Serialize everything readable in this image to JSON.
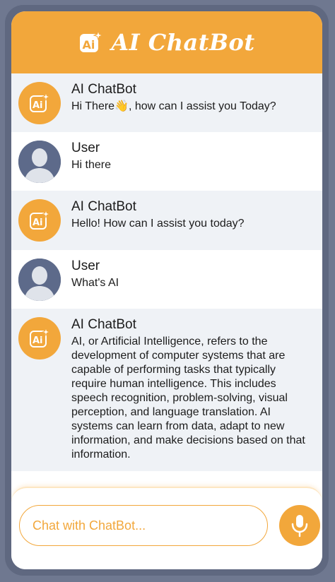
{
  "header": {
    "title": "AI ChatBot",
    "icon": "ai-sparkle-icon"
  },
  "messages": [
    {
      "role": "bot",
      "sender": "AI ChatBot",
      "text": "Hi There👋, how can I assist you Today?"
    },
    {
      "role": "user",
      "sender": "User",
      "text": "Hi there"
    },
    {
      "role": "bot",
      "sender": "AI ChatBot",
      "text": "Hello! How can I assist you today?"
    },
    {
      "role": "user",
      "sender": "User",
      "text": "What's AI"
    },
    {
      "role": "bot",
      "sender": "AI ChatBot",
      "text": "AI, or Artificial Intelligence, refers to the development of computer systems that are capable of performing tasks that typically require human intelligence. This includes speech recognition, problem-solving, visual perception, and language translation. AI systems can learn from data, adapt to new information, and make decisions based on that information."
    }
  ],
  "input": {
    "placeholder": "Chat with ChatBot..."
  },
  "mic_button": {
    "icon": "microphone-icon"
  },
  "colors": {
    "accent": "#f2a73b",
    "bot_row": "#eff2f6",
    "user_avatar": "#5d6a8a",
    "frame": "#5f6880"
  }
}
